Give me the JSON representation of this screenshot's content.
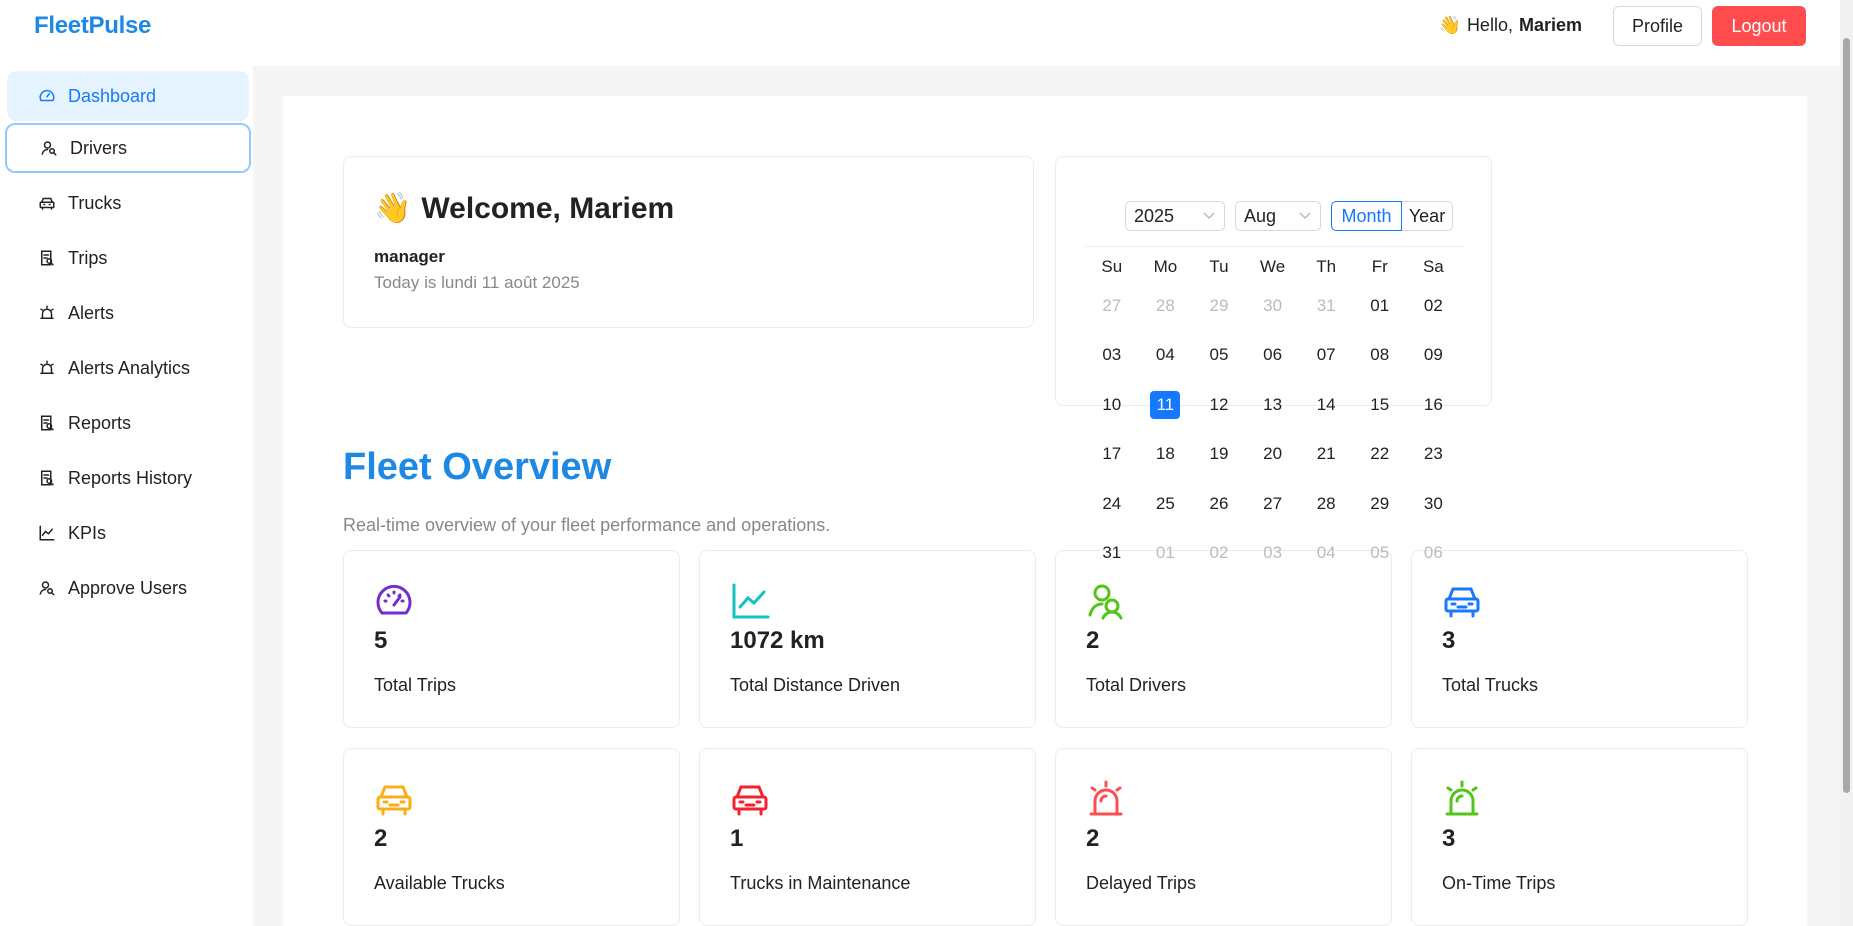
{
  "header": {
    "logo": "FleetPulse",
    "greeting_emoji": "👋",
    "greeting": "Hello,",
    "user_name": "Mariem",
    "profile_label": "Profile",
    "logout_label": "Logout"
  },
  "sidebar": {
    "items": [
      {
        "label": "Dashboard",
        "icon": "dashboard-icon"
      },
      {
        "label": "Drivers",
        "icon": "user-icon"
      },
      {
        "label": "Trucks",
        "icon": "truck-icon"
      },
      {
        "label": "Trips",
        "icon": "trip-icon"
      },
      {
        "label": "Alerts",
        "icon": "alarm-icon"
      },
      {
        "label": "Alerts Analytics",
        "icon": "alarm-icon"
      },
      {
        "label": "Reports",
        "icon": "report-icon"
      },
      {
        "label": "Reports History",
        "icon": "report-icon"
      },
      {
        "label": "KPIs",
        "icon": "line-chart-icon"
      },
      {
        "label": "Approve Users",
        "icon": "user-icon"
      }
    ]
  },
  "welcome": {
    "emoji": "👋",
    "title": "Welcome, Mariem",
    "role": "manager",
    "date_text": "Today is lundi 11 août 2025"
  },
  "calendar": {
    "year": "2025",
    "month": "Aug",
    "mode_month": "Month",
    "mode_year": "Year",
    "weekdays": [
      "Su",
      "Mo",
      "Tu",
      "We",
      "Th",
      "Fr",
      "Sa"
    ],
    "days": [
      [
        "27",
        "28",
        "29",
        "30",
        "31",
        "01",
        "02"
      ],
      [
        "03",
        "04",
        "05",
        "06",
        "07",
        "08",
        "09"
      ],
      [
        "10",
        "11",
        "12",
        "13",
        "14",
        "15",
        "16"
      ],
      [
        "17",
        "18",
        "19",
        "20",
        "21",
        "22",
        "23"
      ],
      [
        "24",
        "25",
        "26",
        "27",
        "28",
        "29",
        "30"
      ],
      [
        "31",
        "01",
        "02",
        "03",
        "04",
        "05",
        "06"
      ]
    ],
    "selected": "11"
  },
  "overview": {
    "title": "Fleet Overview",
    "subtitle": "Real-time overview of your fleet performance and operations."
  },
  "stats": [
    {
      "value": "5",
      "label": "Total Trips",
      "icon": "dashboard-icon",
      "color": "#722ed1"
    },
    {
      "value": "1072 km",
      "label": "Total Distance Driven",
      "icon": "line-chart-icon",
      "color": "#13c2c2"
    },
    {
      "value": "2",
      "label": "Total Drivers",
      "icon": "user-icon",
      "color": "#52c41a"
    },
    {
      "value": "3",
      "label": "Total Trucks",
      "icon": "truck-icon",
      "color": "#1677ff"
    },
    {
      "value": "2",
      "label": "Available Trucks",
      "icon": "truck-icon",
      "color": "#faad14"
    },
    {
      "value": "1",
      "label": "Trucks in Maintenance",
      "icon": "truck-icon",
      "color": "#f5222d"
    },
    {
      "value": "2",
      "label": "Delayed Trips",
      "icon": "alarm-icon",
      "color": "#ff4d4f"
    },
    {
      "value": "3",
      "label": "On-Time Trips",
      "icon": "alarm-icon",
      "color": "#52c41a"
    }
  ],
  "colors": {
    "brand": "#1e88e5",
    "active": "#1677ff",
    "logout": "#ff4d4f"
  }
}
